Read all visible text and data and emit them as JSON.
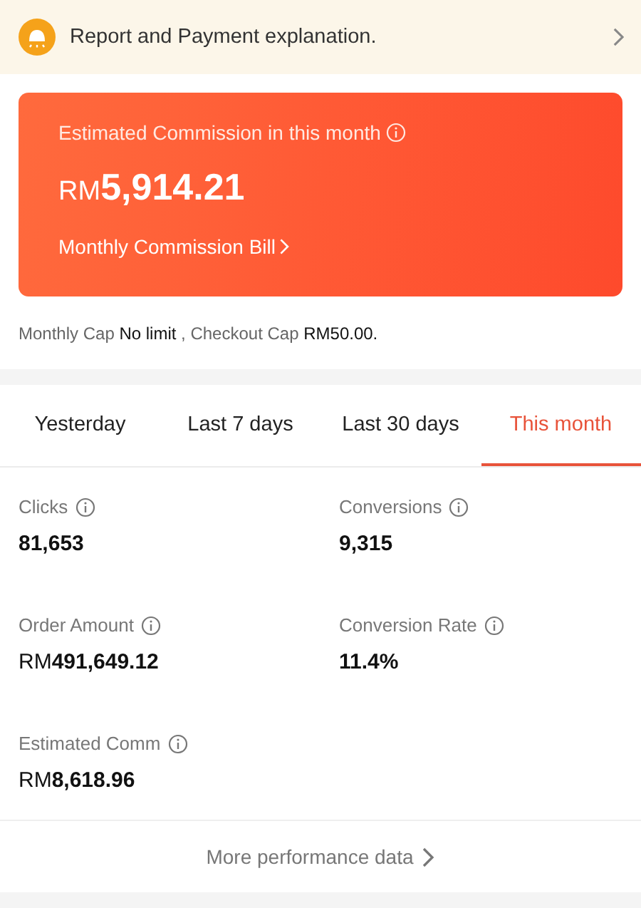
{
  "notice": {
    "text": "Report and Payment explanation."
  },
  "commission_card": {
    "title": "Estimated Commission in this month",
    "amount": "RM**5,914.21**",
    "link": "Monthly Commission Bill"
  },
  "cap_info": "Monthly Cap **No limit** , Checkout Cap **RM50.00.**",
  "tabs": [
    {
      "label": "Yesterday",
      "selected": false
    },
    {
      "label": "Last 7 days",
      "selected": false
    },
    {
      "label": "Last 30 days",
      "selected": false
    },
    {
      "label": "This month",
      "selected": true
    }
  ],
  "metrics": [
    {
      "label": "Clicks",
      "value": "81,653"
    },
    {
      "label": "Conversions",
      "value": "9,315"
    },
    {
      "label": "Order Amount",
      "value": "RM**491,649.12**"
    },
    {
      "label": "Conversion Rate",
      "value": "11.4%"
    },
    {
      "label": "Estimated Comm",
      "value": "RM**8,618.96**"
    }
  ],
  "more_link": "More performance data"
}
